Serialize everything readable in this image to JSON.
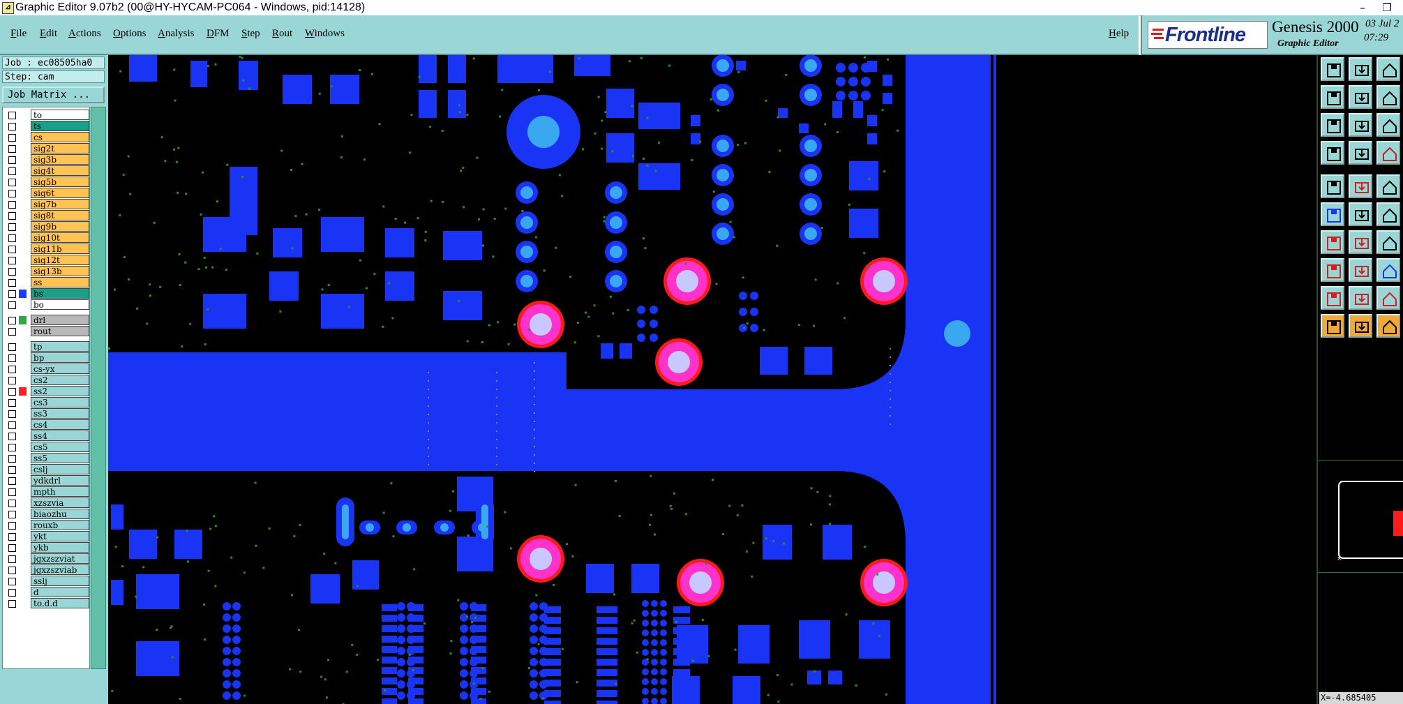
{
  "window": {
    "title": "Graphic Editor 9.07b2 (00@HY-HYCAM-PC064 - Windows, pid:14128)",
    "controls": [
      "–",
      "❐"
    ]
  },
  "menu": [
    "File",
    "Edit",
    "Actions",
    "Options",
    "Analysis",
    "DFM",
    "Step",
    "Rout",
    "Windows"
  ],
  "help_label": "Help",
  "brand": {
    "logo": "Frontline",
    "product": "Genesis 2000",
    "subtitle": "Graphic Editor",
    "date": "03 Jul 2",
    "time": "07:29"
  },
  "job": {
    "job_label": "Job : ec08505ha0",
    "step_label": "Step: cam",
    "matrix_button": "Job Matrix ..."
  },
  "layers": [
    {
      "name": "to",
      "bg": "#ffffff",
      "swatch": ""
    },
    {
      "name": "ts",
      "bg": "#1aa089",
      "swatch": ""
    },
    {
      "name": "cs",
      "bg": "#ffc354",
      "swatch": ""
    },
    {
      "name": "sig2t",
      "bg": "#ffc354",
      "swatch": ""
    },
    {
      "name": "sig3b",
      "bg": "#ffc354",
      "swatch": ""
    },
    {
      "name": "sig4t",
      "bg": "#ffc354",
      "swatch": ""
    },
    {
      "name": "sig5b",
      "bg": "#ffc354",
      "swatch": ""
    },
    {
      "name": "sig6t",
      "bg": "#ffc354",
      "swatch": ""
    },
    {
      "name": "sig7b",
      "bg": "#ffc354",
      "swatch": ""
    },
    {
      "name": "sig8t",
      "bg": "#ffc354",
      "swatch": ""
    },
    {
      "name": "sig9b",
      "bg": "#ffc354",
      "swatch": ""
    },
    {
      "name": "sig10t",
      "bg": "#ffc354",
      "swatch": ""
    },
    {
      "name": "sig11b",
      "bg": "#ffc354",
      "swatch": ""
    },
    {
      "name": "sig12t",
      "bg": "#ffc354",
      "swatch": ""
    },
    {
      "name": "sig13b",
      "bg": "#ffc354",
      "swatch": ""
    },
    {
      "name": "ss",
      "bg": "#ffc354",
      "swatch": ""
    },
    {
      "name": "bs",
      "bg": "#1aa089",
      "swatch": "#1a3cff"
    },
    {
      "name": "bo",
      "bg": "#ffffff",
      "swatch": ""
    },
    {
      "name": "drl",
      "bg": "#b8b8b8",
      "swatch": "#2fa84a"
    },
    {
      "name": "rout",
      "bg": "#b8b8b8",
      "swatch": ""
    },
    {
      "name": "tp",
      "bg": "#9bd6d6",
      "swatch": ""
    },
    {
      "name": "bp",
      "bg": "#9bd6d6",
      "swatch": ""
    },
    {
      "name": "cs-yx",
      "bg": "#9bd6d6",
      "swatch": ""
    },
    {
      "name": "cs2",
      "bg": "#9bd6d6",
      "swatch": ""
    },
    {
      "name": "ss2",
      "bg": "#9bd6d6",
      "swatch": "#ff2020"
    },
    {
      "name": "cs3",
      "bg": "#9bd6d6",
      "swatch": ""
    },
    {
      "name": "ss3",
      "bg": "#9bd6d6",
      "swatch": ""
    },
    {
      "name": "cs4",
      "bg": "#9bd6d6",
      "swatch": ""
    },
    {
      "name": "ss4",
      "bg": "#9bd6d6",
      "swatch": ""
    },
    {
      "name": "cs5",
      "bg": "#9bd6d6",
      "swatch": ""
    },
    {
      "name": "ss5",
      "bg": "#9bd6d6",
      "swatch": ""
    },
    {
      "name": "cslj",
      "bg": "#9bd6d6",
      "swatch": ""
    },
    {
      "name": "ydkdrl",
      "bg": "#9bd6d6",
      "swatch": ""
    },
    {
      "name": "mpth",
      "bg": "#9bd6d6",
      "swatch": ""
    },
    {
      "name": "xzszvia",
      "bg": "#9bd6d6",
      "swatch": ""
    },
    {
      "name": "biaozhu",
      "bg": "#9bd6d6",
      "swatch": ""
    },
    {
      "name": "rouxb",
      "bg": "#9bd6d6",
      "swatch": ""
    },
    {
      "name": "ykt",
      "bg": "#9bd6d6",
      "swatch": ""
    },
    {
      "name": "ykb",
      "bg": "#9bd6d6",
      "swatch": ""
    },
    {
      "name": "jgxzszviat",
      "bg": "#9bd6d6",
      "swatch": ""
    },
    {
      "name": "jgxzszviab",
      "bg": "#9bd6d6",
      "swatch": ""
    },
    {
      "name": "sslj",
      "bg": "#9bd6d6",
      "swatch": ""
    },
    {
      "name": "d",
      "bg": "#9bd6d6",
      "swatch": ""
    },
    {
      "name": "to.d.d",
      "bg": "#9bd6d6",
      "swatch": ""
    }
  ],
  "tools": [
    "save-icon",
    "open-icon",
    "home-icon",
    "pan-left-icon",
    "pan-right-icon",
    "zoom-back-icon",
    "zoom-fit-icon",
    "zoom-profile-icon",
    "one-to-one-icon",
    "measure-icon",
    "grid-icon",
    "snap-icon",
    "select-icon",
    "erase-icon",
    "ruler-icon",
    "connect-icon",
    "delete-icon",
    "rotate-icon",
    "line-icon",
    "arc-icon",
    "undo-icon",
    "pad-icon",
    "dimension-icon",
    "stretch-icon",
    "triangle-icon",
    "text-a-icon",
    "text-b-icon",
    "pointer-icon",
    "pointer-select-icon",
    "pointer-move-icon"
  ],
  "coordinates": "X=-4.685405"
}
